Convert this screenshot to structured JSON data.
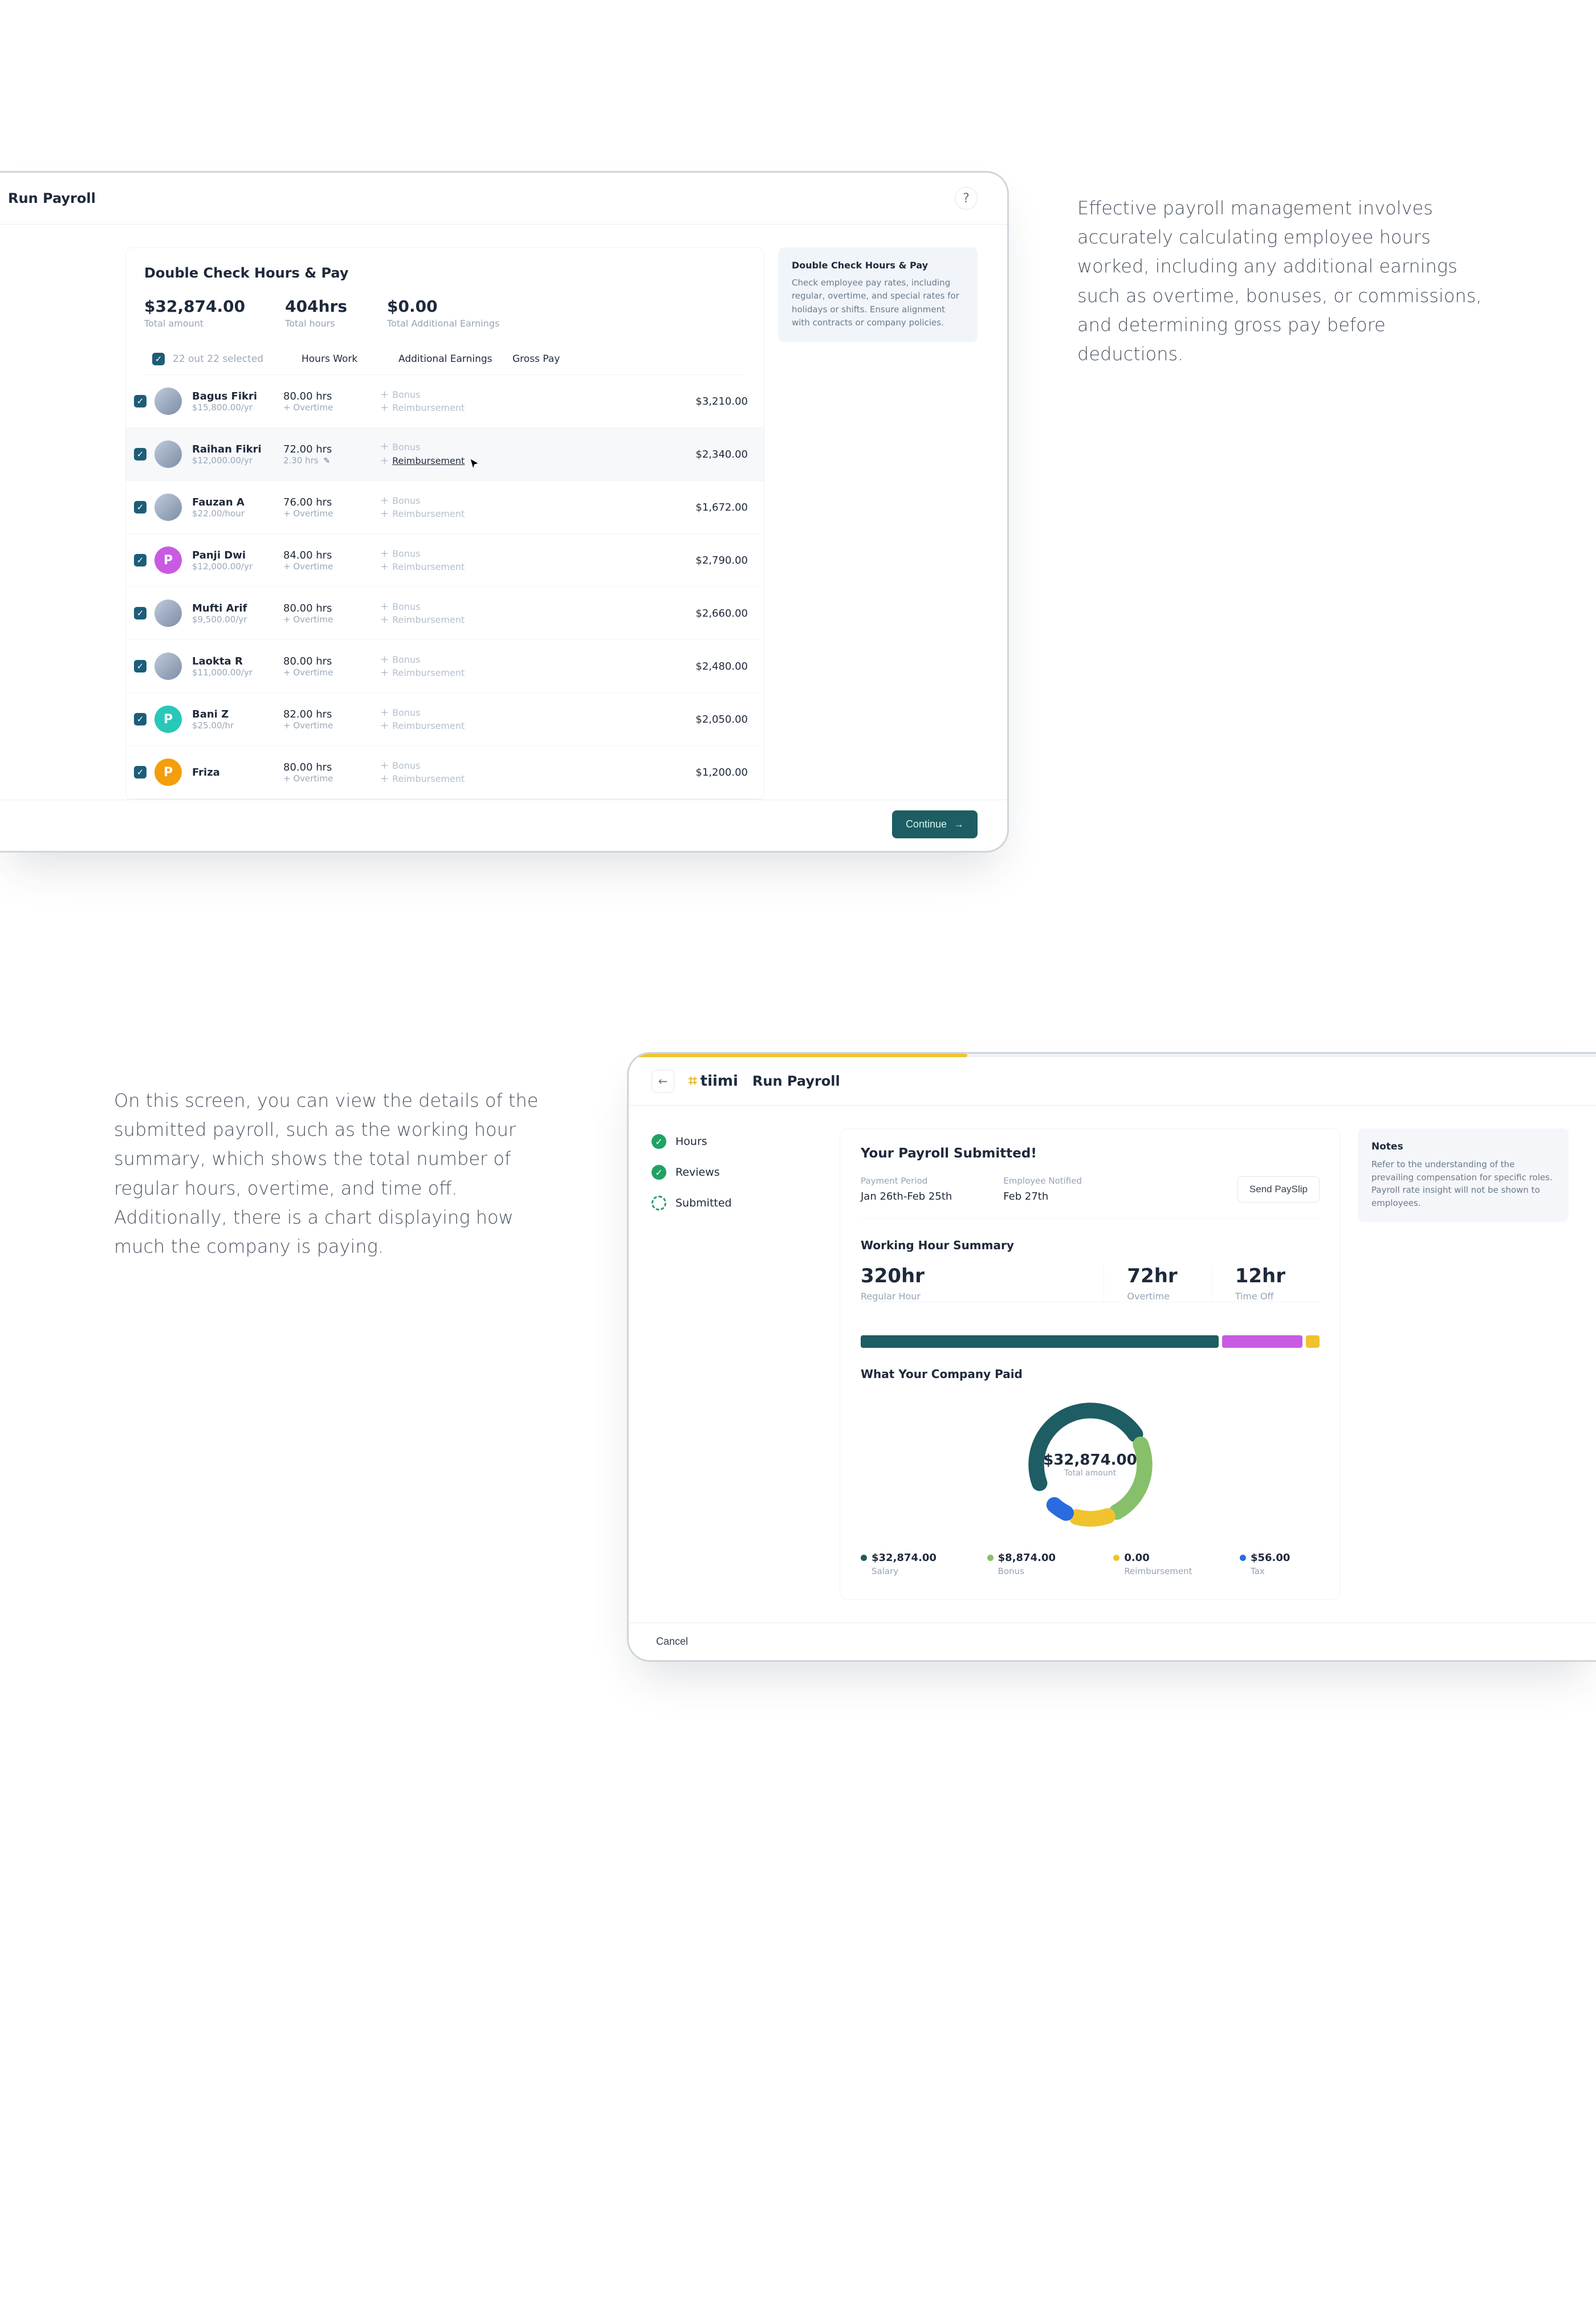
{
  "section1": {
    "title": "Run Payroll",
    "card_title": "Double Check Hours & Pay",
    "summary": [
      {
        "value": "$32,874.00",
        "label": "Total amount"
      },
      {
        "value": "404hrs",
        "label": "Total hours"
      },
      {
        "value": "$0.00",
        "label": "Total Additional Earnings"
      }
    ],
    "selected_text": "22 out 22 selected",
    "columns": {
      "hours": "Hours Work",
      "earnings": "Additional Earnings",
      "gross": "Gross Pay"
    },
    "bonus_label": "Bonus",
    "reimb_label": "Reimbursement",
    "overtime_label": "Overtime",
    "rows": [
      {
        "name": "Bagus Fikri",
        "sub": "$15,800.00/yr",
        "hours": "80.00 hrs",
        "gross": "$3,210.00",
        "avatar": "img"
      },
      {
        "name": "Raihan Fikri",
        "sub": "$12,000.00/yr",
        "hours": "72.00 hrs",
        "extra": "2.30 hrs",
        "gross": "$2,340.00",
        "avatar": "img",
        "highlight": true,
        "cursor": true
      },
      {
        "name": "Fauzan A",
        "sub": "$22.00/hour",
        "hours": "76.00 hrs",
        "gross": "$1,672.00",
        "avatar": "img"
      },
      {
        "name": "Panji Dwi",
        "sub": "$12,000.00/yr",
        "hours": "84.00 hrs",
        "gross": "$2,790.00",
        "avatar": "P",
        "avclass": "av-p"
      },
      {
        "name": "Mufti Arif",
        "sub": "$9,500.00/yr",
        "hours": "80.00 hrs",
        "gross": "$2,660.00",
        "avatar": "img"
      },
      {
        "name": "Laokta R",
        "sub": "$11,000.00/yr",
        "hours": "80.00 hrs",
        "gross": "$2,480.00",
        "avatar": "img"
      },
      {
        "name": "Bani Z",
        "sub": "$25.00/hr",
        "hours": "82.00 hrs",
        "gross": "$2,050.00",
        "avatar": "P",
        "avclass": "av-b"
      },
      {
        "name": "Friza",
        "sub": "",
        "hours": "80.00 hrs",
        "gross": "$1,200.00",
        "avatar": "P",
        "avclass": "av-o"
      }
    ],
    "aside": {
      "title": "Double Check Hours & Pay",
      "body": "Check employee pay rates, including regular, overtime, and special rates for holidays or shifts. Ensure alignment with contracts or company policies."
    },
    "continue": "Continue",
    "caption": "Effective payroll management involves accurately calculating employee hours worked, including any additional earnings such as overtime, bonuses, or commissions, and determining gross pay before deductions."
  },
  "section2": {
    "logo": "tiimi",
    "title": "Run Payroll",
    "steps": [
      {
        "label": "Hours",
        "state": "done"
      },
      {
        "label": "Reviews",
        "state": "done"
      },
      {
        "label": "Submitted",
        "state": "active"
      }
    ],
    "card": {
      "heading": "Your Payroll Submitted!",
      "period_label": "Payment Period",
      "period": "Jan 26th-Feb 25th",
      "notified_label": "Employee Notified",
      "notified": "Feb 27th",
      "payslip": "Send PaySlip",
      "wh_heading": "Working Hour Summary",
      "wh": [
        {
          "value": "320hr",
          "label": "Regular Hour"
        },
        {
          "value": "72hr",
          "label": "Overtime"
        },
        {
          "value": "12hr",
          "label": "Time Off"
        }
      ],
      "paid_heading": "What Your Company Paid",
      "total_amount": "$32,874.00",
      "total_label": "Total amount",
      "legend": [
        {
          "dot": "#1d5d63",
          "value": "$32,874.00",
          "label": "Salary"
        },
        {
          "dot": "#86c06a",
          "value": "$8,874.00",
          "label": "Bonus"
        },
        {
          "dot": "#f0c32e",
          "value": "0.00",
          "label": "Reimbursement"
        },
        {
          "dot": "#2a6be0",
          "value": "$56.00",
          "label": "Tax"
        }
      ]
    },
    "aside": {
      "title": "Notes",
      "body": "Refer to the understanding of the prevailing compensation for specific roles. Payroll rate insight will not be shown to employees."
    },
    "cancel": "Cancel",
    "caption": "On this screen, you can view the details of the submitted payroll, such as the working hour summary, which shows the total number of regular hours, overtime, and time off. Additionally, there is a chart displaying how much the company is paying."
  },
  "chart_data": [
    {
      "type": "bar",
      "orientation": "horizontal-stacked",
      "title": "Working Hour Summary",
      "series": [
        {
          "name": "Regular Hour",
          "value": 320,
          "color": "#1d5d63"
        },
        {
          "name": "Overtime",
          "value": 72,
          "color": "#c85be2"
        },
        {
          "name": "Time Off",
          "value": 12,
          "color": "#f0c32e"
        }
      ]
    },
    {
      "type": "pie",
      "style": "donut",
      "title": "What Your Company Paid",
      "total": 32874.0,
      "unit": "USD",
      "series": [
        {
          "name": "Salary",
          "value": 32874.0,
          "color": "#1d5d63"
        },
        {
          "name": "Bonus",
          "value": 8874.0,
          "color": "#86c06a"
        },
        {
          "name": "Reimbursement",
          "value": 0.0,
          "color": "#f0c32e"
        },
        {
          "name": "Tax",
          "value": 56.0,
          "color": "#2a6be0"
        }
      ]
    }
  ]
}
